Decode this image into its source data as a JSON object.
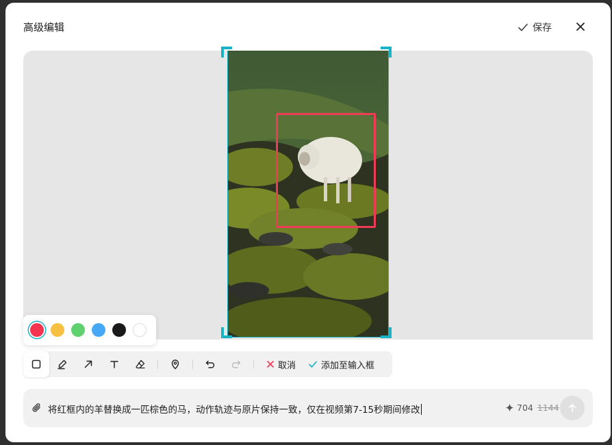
{
  "dialog": {
    "title": "高级编辑",
    "save_label": "保存"
  },
  "palette": {
    "colors": [
      "#f5344f",
      "#f7c043",
      "#5fd16f",
      "#47a9f5",
      "#1a1a1a",
      "#ffffff"
    ],
    "selected": "#f5344f"
  },
  "toolbar": {
    "tools": [
      "rectangle-icon",
      "pen-icon",
      "arrow-icon",
      "text-icon",
      "eraser-icon",
      "location-pin-icon",
      "undo-icon",
      "redo-icon"
    ],
    "cancel_label": "取消",
    "add_label": "添加至输入框"
  },
  "input": {
    "prompt_text": "将红框内的羊替换成一匹棕色的马，动作轨迹与原片保持一致，仅在视频第7-15秒期间修改",
    "credits": "704",
    "credits_original": "1144"
  },
  "colors": {
    "accent": "#1ab3c6",
    "annotation_red": "#ef3b55"
  }
}
